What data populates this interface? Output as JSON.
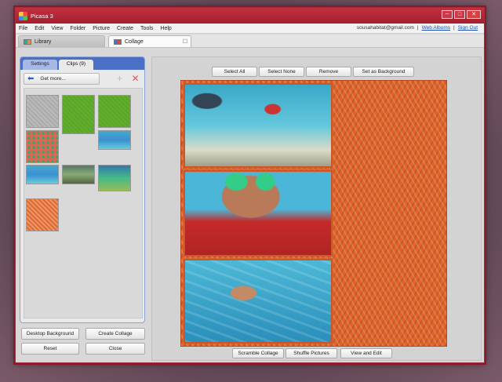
{
  "window": {
    "title": "Picasa 3"
  },
  "menu": [
    "File",
    "Edit",
    "View",
    "Folder",
    "Picture",
    "Create",
    "Tools",
    "Help"
  ],
  "account": {
    "email": "sousahabitat@gmail.com",
    "web_albums": "Web Albums",
    "sign_out": "Sign Out",
    "sep": "|"
  },
  "tabs": {
    "library": "Library",
    "collage": "Collage"
  },
  "panel": {
    "settings_tab": "Settings",
    "clips_tab": "Clips (9)",
    "get_more": "Get more...",
    "desktop_background": "Desktop Background",
    "create_collage": "Create Collage",
    "reset": "Reset",
    "close": "Close"
  },
  "toolbar_top": {
    "select_all": "Select All",
    "select_none": "Select None",
    "remove": "Remove",
    "set_background": "Set as Background"
  },
  "toolbar_bottom": {
    "scramble": "Scramble Collage",
    "shuffle": "Shuffle Pictures",
    "view_edit": "View and Edit"
  },
  "colors": {
    "titlebar": "#b0283a",
    "accent_blue": "#4a6fc4",
    "collage_bg": "#e0642a"
  },
  "icons": {
    "back": "back-arrow-icon",
    "add": "plus-icon",
    "remove": "x-icon"
  },
  "glyphs": {
    "minimize": "─",
    "maximize": "□",
    "close": "✕",
    "tab_close": "☐",
    "back": "⬅",
    "plus": "+",
    "x": "✕"
  }
}
